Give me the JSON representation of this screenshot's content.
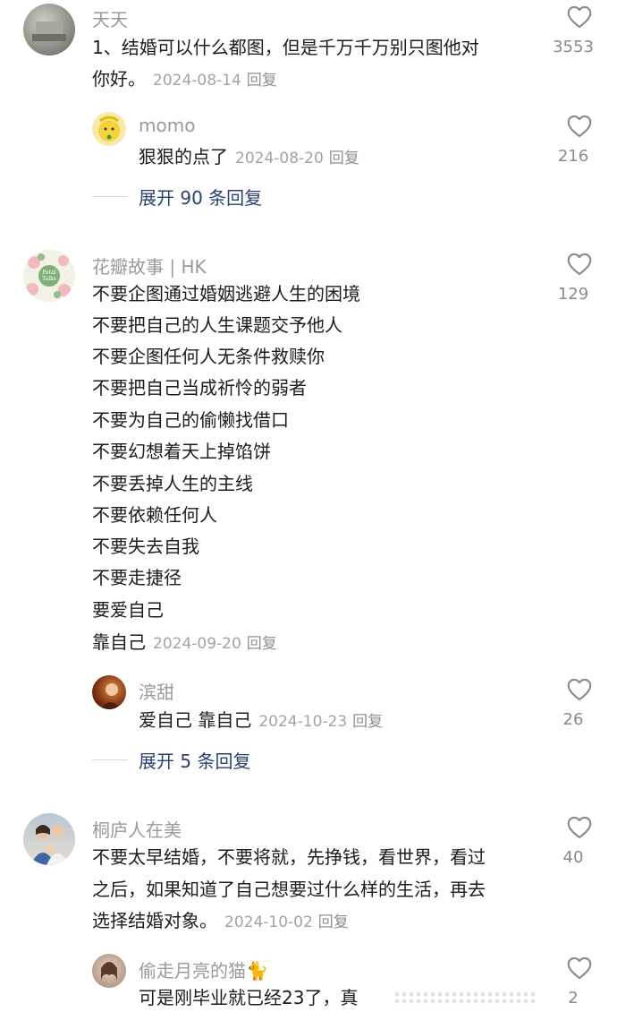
{
  "comments": [
    {
      "user": "天天",
      "lines": [
        "1、结婚可以什么都图，但是千万千万别只图他对",
        "你好。"
      ],
      "date": "2024-08-14",
      "reply": "回复",
      "likes": "3553",
      "sub": [
        {
          "user": "momo",
          "text": "狠狠的点了",
          "date": "2024-08-20",
          "reply": "回复",
          "likes": "216"
        }
      ],
      "expand": "展开 90 条回复"
    },
    {
      "user": "花瓣故事 | HK",
      "lines": [
        "不要企图通过婚姻逃避人生的困境",
        "不要把自己的人生课题交予他人",
        "不要企图任何人无条件救赎你",
        "不要把自己当成祈怜的弱者",
        "不要为自己的偷懒找借口",
        "不要幻想着天上掉馅饼",
        "不要丢掉人生的主线",
        "不要依赖任何人",
        "不要失去自我",
        "不要走捷径",
        "要爱自己",
        "靠自己"
      ],
      "date": "2024-09-20",
      "reply": "回复",
      "likes": "129",
      "sub": [
        {
          "user": "滨甜",
          "text": "爱自己 靠自己",
          "date": "2024-10-23",
          "reply": "回复",
          "likes": "26"
        }
      ],
      "expand": "展开 5 条回复"
    },
    {
      "user": "桐庐人在美",
      "lines": [
        "不要太早结婚，不要将就，先挣钱，看世界，看过",
        "之后，如果知道了自己想要过什么样的生活，再去",
        "选择结婚对象。"
      ],
      "date": "2024-10-02",
      "reply": "回复",
      "likes": "40",
      "sub": [
        {
          "user": "偷走月亮的猫🐈",
          "text": "可是刚毕业就已经23了，真",
          "date": "",
          "reply": "",
          "likes": "2"
        }
      ]
    }
  ],
  "colors": {
    "username": "#9a9a9a",
    "meta": "#a3a3a3",
    "expand": "#2a3f72",
    "text": "#1c1c1c"
  },
  "icons": {
    "like": "heart-outline-icon"
  }
}
